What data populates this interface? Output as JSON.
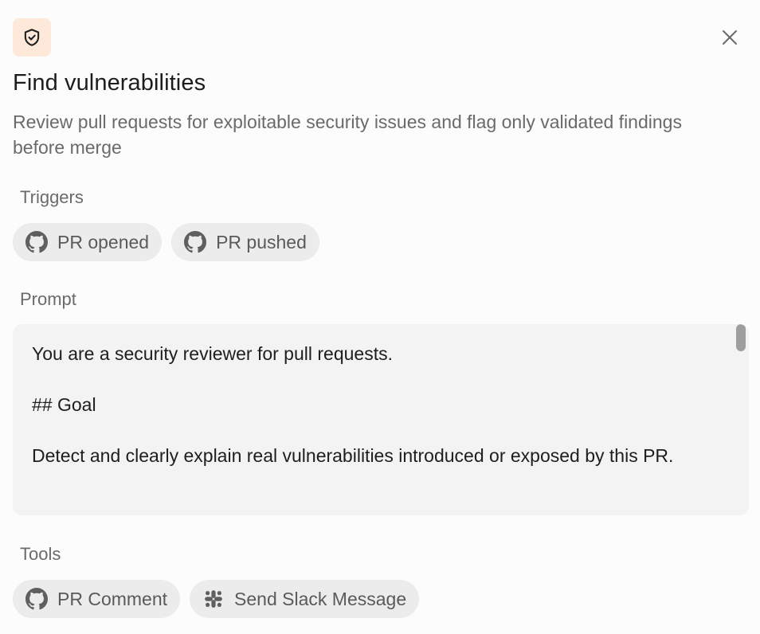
{
  "header": {
    "icon": "shield-check-icon",
    "icon_bg": "#fde8d9",
    "close_icon": "close-icon",
    "title": "Find vulnerabilities",
    "description": "Review pull requests for exploitable security issues and flag only validated findings before merge"
  },
  "triggers": {
    "label": "Triggers",
    "items": [
      {
        "icon": "github-icon",
        "label": "PR opened"
      },
      {
        "icon": "github-icon",
        "label": "PR pushed"
      }
    ]
  },
  "prompt": {
    "label": "Prompt",
    "paragraphs": [
      "You are a security reviewer for pull requests.",
      "## Goal",
      "Detect and clearly explain real vulnerabilities introduced or exposed by this PR."
    ]
  },
  "tools": {
    "label": "Tools",
    "items": [
      {
        "icon": "github-icon",
        "label": "PR Comment"
      },
      {
        "icon": "slack-icon",
        "label": "Send Slack Message"
      }
    ]
  }
}
